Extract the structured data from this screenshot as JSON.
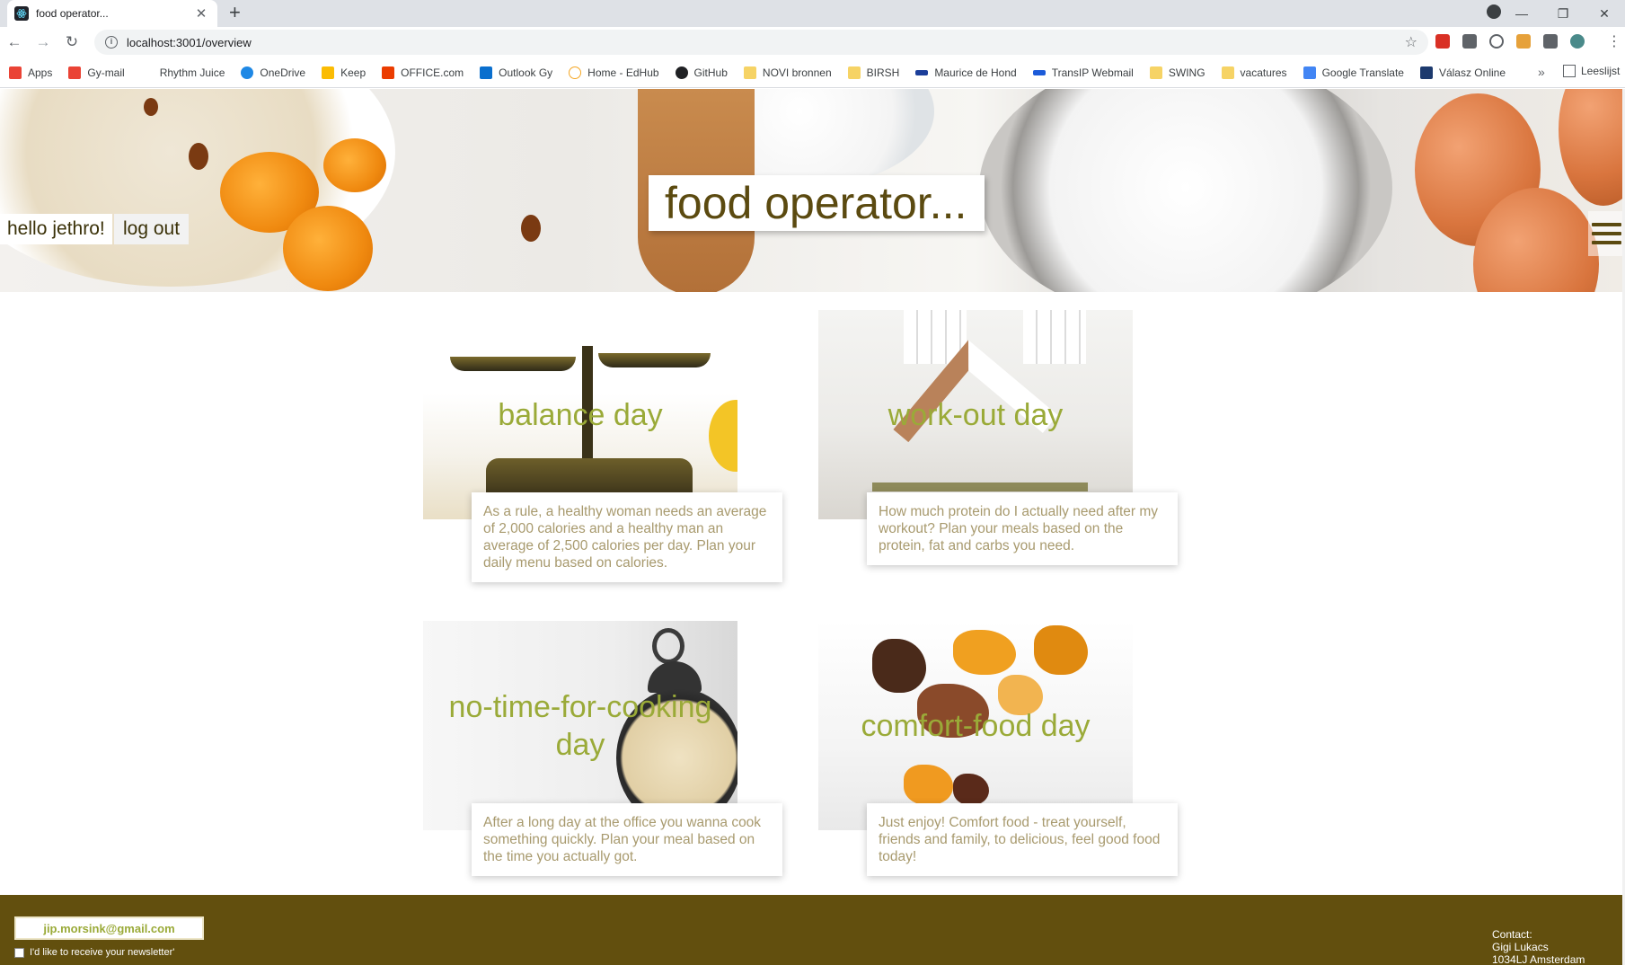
{
  "browser": {
    "tab_title": "food operator...",
    "url": "localhost:3001/overview",
    "bookmarks": [
      {
        "label": "Apps",
        "color": "#ea4335"
      },
      {
        "label": "Gy-mail",
        "color": "#ea4335"
      },
      {
        "label": "Rhythm Juice",
        "color": "#ffffff"
      },
      {
        "label": "OneDrive",
        "color": "#1e88e5"
      },
      {
        "label": "Keep",
        "color": "#fbbc04"
      },
      {
        "label": "OFFICE.com",
        "color": "#eb3c00"
      },
      {
        "label": "Outlook Gy",
        "color": "#0a6fce"
      },
      {
        "label": "Home - EdHub",
        "color": "#f5a623"
      },
      {
        "label": "GitHub",
        "color": "#202124"
      },
      {
        "label": "NOVI bronnen",
        "color": "#f6d365"
      },
      {
        "label": "BIRSH",
        "color": "#f6d365"
      },
      {
        "label": "Maurice de Hond",
        "color": "#1b3e9a"
      },
      {
        "label": "TransIP Webmail",
        "color": "#1c5bd9"
      },
      {
        "label": "SWING",
        "color": "#f6d365"
      },
      {
        "label": "vacatures",
        "color": "#f6d365"
      },
      {
        "label": "Google Translate",
        "color": "#4285f4"
      },
      {
        "label": "Válasz Online",
        "color": "#1d3a6e"
      }
    ],
    "reading_list": "Leeslijst"
  },
  "header": {
    "brand": "food operator...",
    "greeting": "hello",
    "username": "jethro!",
    "logout": "log out"
  },
  "cards": [
    {
      "title": "balance day",
      "text": "As a rule, a healthy woman needs an average of 2,000 calories and a healthy man an average of 2,500 calories per day. Plan your daily menu based on calories."
    },
    {
      "title": "work-out day",
      "text": "How much protein do I actually need after my workout? Plan your meals based on the protein, fat and carbs you need."
    },
    {
      "title": "no-time-for-cooking day",
      "text": "After a long day at the office you wanna cook something quickly. Plan your meal based on the time you actually got."
    },
    {
      "title": "comfort-food day",
      "text": "Just enjoy! Comfort food - treat yourself, friends and family, to delicious, feel good food today!"
    }
  ],
  "footer": {
    "email": "jip.morsink@gmail.com",
    "newsletter": "I'd like to receive your newsletter'",
    "contact_label": "Contact:",
    "contact_name": "Gigi Lukacs",
    "contact_address": "1034LJ Amsterdam"
  },
  "colors": {
    "brand_text": "#5b4a10",
    "card_title": "#9aaa38",
    "footer_bg": "#624f0e"
  }
}
